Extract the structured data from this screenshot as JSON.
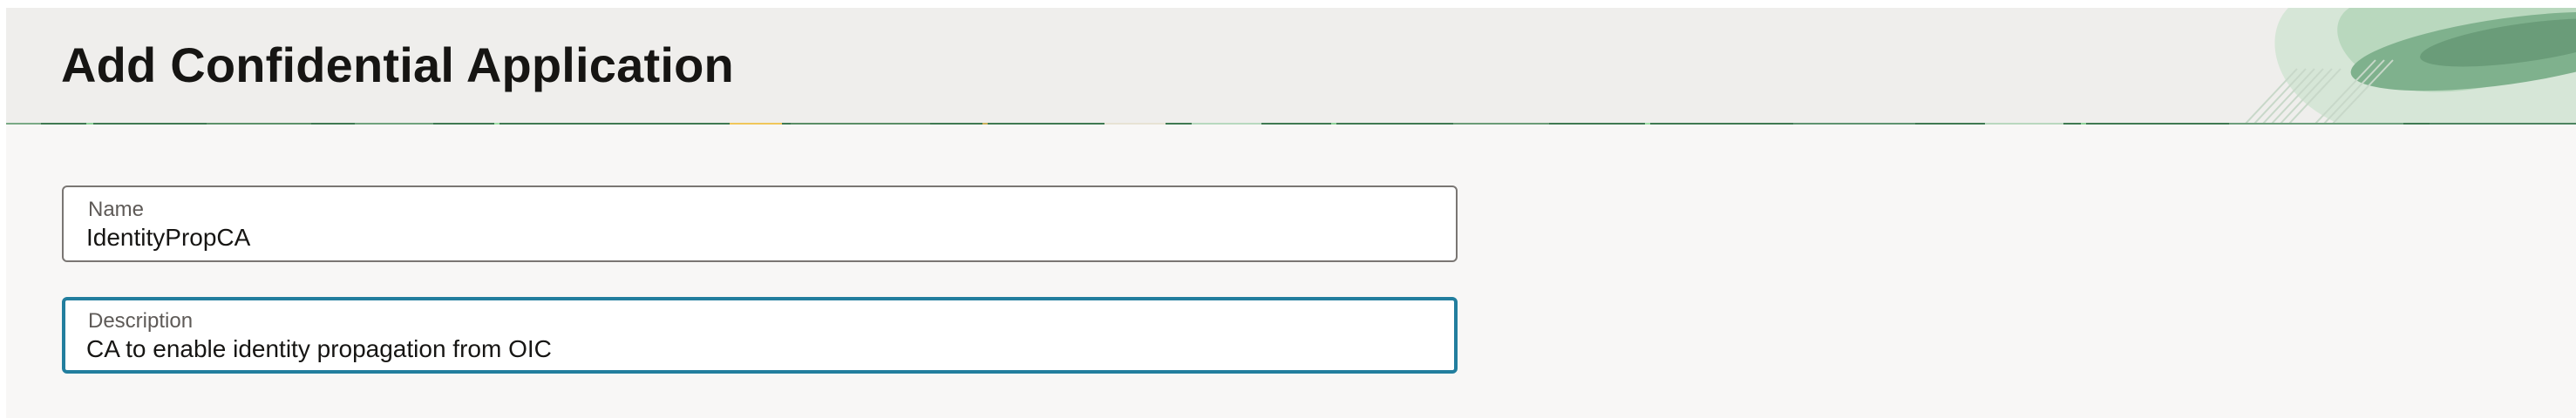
{
  "page": {
    "title": "Add Confidential Application"
  },
  "form": {
    "name": {
      "label": "Name",
      "value": "IdentityPropCA"
    },
    "description": {
      "label": "Description",
      "value": "CA to enable identity propagation from OIC",
      "focused": true
    }
  },
  "colors": {
    "header_bg": "#efeeec",
    "page_bg": "#f8f7f6",
    "focus_border": "#227e9e",
    "banner_green": "#3f7a52",
    "banner_yellow": "#f0c75a",
    "text_primary": "#161513",
    "label_gray": "#5e5a57"
  }
}
